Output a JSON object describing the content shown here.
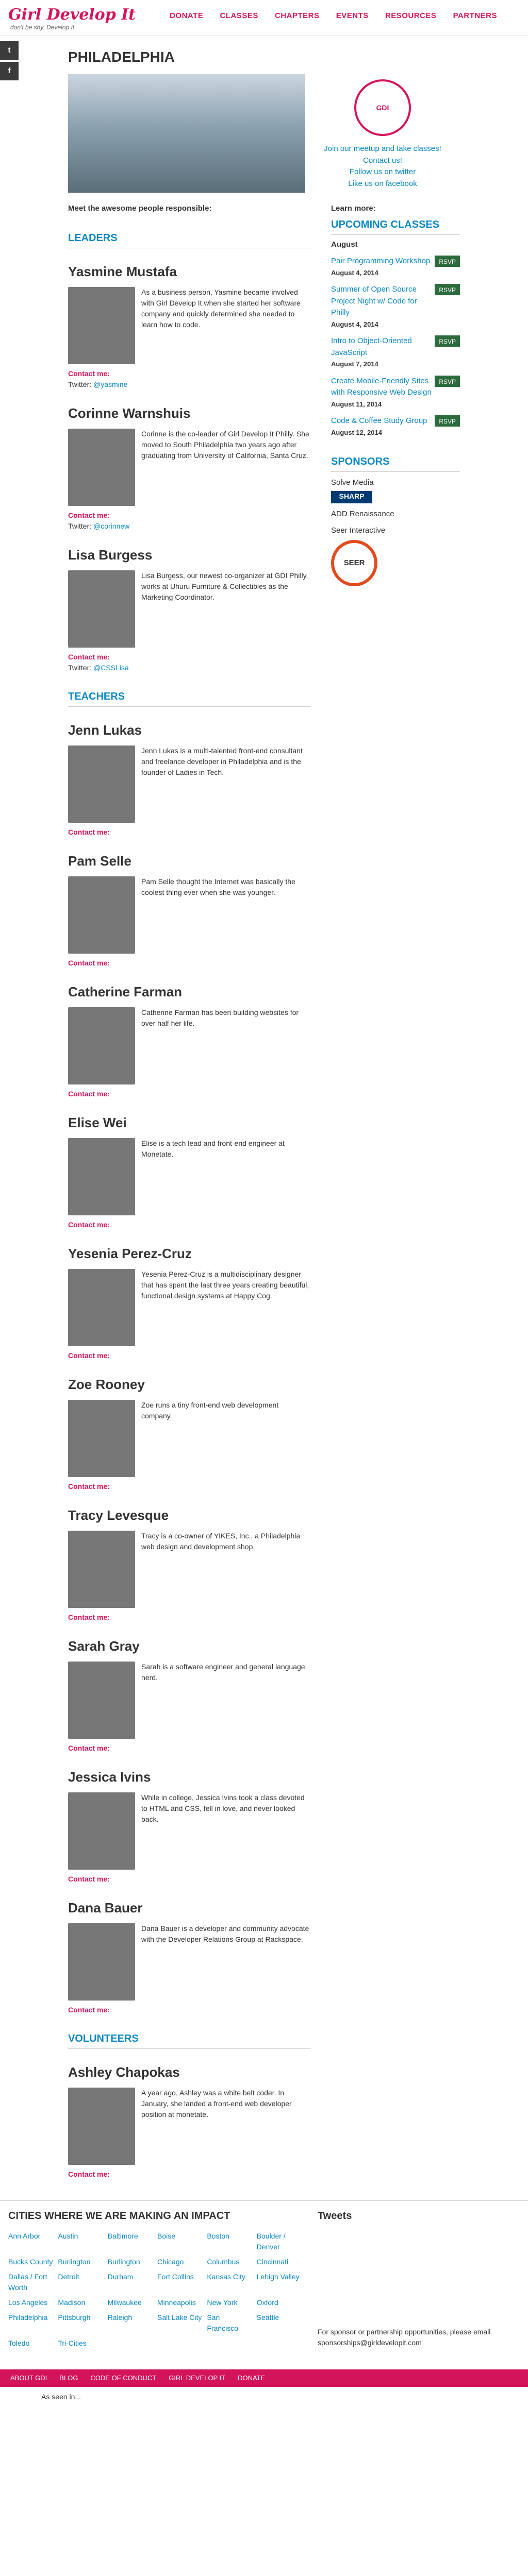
{
  "header": {
    "logo": "Girl Develop It",
    "tagline": "don't be shy. Develop It.",
    "nav": [
      "DONATE",
      "CLASSES",
      "CHAPTERS",
      "EVENTS",
      "RESOURCES",
      "PARTNERS"
    ]
  },
  "page": {
    "title": "PHILADELPHIA",
    "meet": "Meet the awesome people responsible:",
    "join": "Join our meetup and take classes!",
    "contact": "Contact us!",
    "twitter": "Follow us on twitter",
    "facebook": "Like us on facebook"
  },
  "leaders_title": "LEADERS",
  "leaders": [
    {
      "name": "Yasmine Mustafa",
      "bio": "As a business person, Yasmine became involved with Girl Develop It when she started her software company and quickly determined she needed to learn how to code.",
      "twitter": "@yasmine"
    },
    {
      "name": "Corinne Warnshuis",
      "bio": "Corinne is the co-leader of Girl Develop It Philly. She moved to South Philadelphia two years ago after graduating from University of California, Santa Cruz.",
      "twitter": "@corinnew"
    },
    {
      "name": "Lisa Burgess",
      "bio": "Lisa Burgess, our newest co-organizer at GDI Philly, works at Uhuru Furniture & Collectibles as the Marketing Coordinator.",
      "twitter": "@CSSLisa"
    }
  ],
  "teachers_title": "TEACHERS",
  "teachers": [
    {
      "name": "Jenn Lukas",
      "bio": "Jenn Lukas is a multi-talented front-end consultant and freelance developer in Philadelphia and is the founder of Ladies in Tech."
    },
    {
      "name": "Pam Selle",
      "bio": "Pam Selle thought the Internet was basically the coolest thing ever when she was younger."
    },
    {
      "name": "Catherine Farman",
      "bio": "Catherine Farman has been building websites for over half her life."
    },
    {
      "name": "Elise Wei",
      "bio": "Elise is a tech lead and front-end engineer at Monetate."
    },
    {
      "name": "Yesenia Perez-Cruz",
      "bio": "Yesenia Perez-Cruz is a multidisciplinary designer that has spent the last three years creating beautiful, functional design systems at Happy Cog."
    },
    {
      "name": "Zoe Rooney",
      "bio": "Zoe runs a tiny front-end web development company."
    },
    {
      "name": "Tracy Levesque",
      "bio": "Tracy is a co-owner of YIKES, Inc., a Philadelphia web design and development shop."
    },
    {
      "name": "Sarah Gray",
      "bio": "Sarah is a software engineer and general language nerd."
    },
    {
      "name": "Jessica Ivins",
      "bio": "While in college, Jessica Ivins took a class devoted to HTML and CSS, fell in love, and never looked back."
    },
    {
      "name": "Dana Bauer",
      "bio": "Dana Bauer is a developer and community advocate with the Developer Relations Group at Rackspace."
    }
  ],
  "volunteers_title": "VOLUNTEERS",
  "volunteers": [
    {
      "name": "Ashley Chapokas",
      "bio": "A year ago, Ashley was a white belt coder. In January, she landed a front-end web developer position at monetate."
    }
  ],
  "contact_label": "Contact me:",
  "aside": {
    "learn_more": "Learn more:",
    "upcoming": "UPCOMING CLASSES",
    "month": "August",
    "events": [
      {
        "title": "Pair Programming Workshop",
        "date": "August 4, 2014"
      },
      {
        "title": "Summer of Open Source Project Night w/ Code for Philly",
        "date": "August 4, 2014"
      },
      {
        "title": "Intro to Object-Oriented JavaScript",
        "date": "August 7, 2014"
      },
      {
        "title": "Create Mobile-Friendly Sites with Responsive Web Design",
        "date": "August 11, 2014"
      },
      {
        "title": "Code & Coffee Study Group",
        "date": "August 12, 2014"
      }
    ],
    "rsvp": "RSVP",
    "sponsors": "SPONSORS",
    "sponsor_names": [
      "Solve Media",
      "ADD Renaissance",
      "Seer Interactive"
    ]
  },
  "impact": {
    "title": "CITIES WHERE WE ARE MAKING AN IMPACT",
    "cities": [
      "Ann Arbor",
      "Austin",
      "Baltimore",
      "Boise",
      "Boston",
      "Boulder / Denver",
      "Bucks County",
      "Burlington",
      "Burlington",
      "Chicago",
      "Columbus",
      "Cincinnati",
      "Dallas / Fort Worth",
      "Detroit",
      "Durham",
      "Fort Collins",
      "Kansas City",
      "Lehigh Valley",
      "Los Angeles",
      "Madison",
      "Milwaukee",
      "Minneapolis",
      "New York",
      "Oxford",
      "Philadelphia",
      "Pittsburgh",
      "Raleigh",
      "Salt Lake City",
      "San Francisco",
      "Seattle",
      "Toledo",
      "Tri-Cities"
    ],
    "tweets": "Tweets",
    "sponsor_note": "For sponsor or partnership opportunities, please email sponsorships@girldevelopit.com"
  },
  "footer": {
    "links": [
      "ABOUT GDI",
      "BLOG",
      "CODE OF CONDUCT",
      "GIRL DEVELOP IT",
      "DONATE"
    ],
    "as_seen": "As seen in..."
  }
}
